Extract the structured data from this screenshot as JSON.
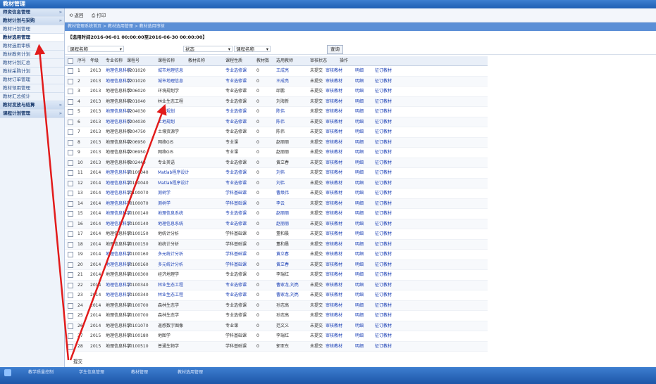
{
  "window": {
    "title": "教材管理"
  },
  "sidebar": {
    "items": [
      {
        "label": "师资信息管理",
        "group": true
      },
      {
        "label": "教材计划与采购",
        "group": true
      },
      {
        "label": "教材计划管理",
        "group": false
      },
      {
        "label": "教材选用管理",
        "group": false,
        "selected": true
      },
      {
        "label": "教材选用审核",
        "group": false
      },
      {
        "label": "教材教务计划",
        "group": false
      },
      {
        "label": "教材计划汇总",
        "group": false
      },
      {
        "label": "教材采购计划",
        "group": false
      },
      {
        "label": "教材订单管理",
        "group": false
      },
      {
        "label": "教材领用管理",
        "group": false
      },
      {
        "label": "教材汇总统计",
        "group": false
      },
      {
        "label": "教材发放与结算",
        "group": true
      },
      {
        "label": "课程计划管理",
        "group": true
      }
    ]
  },
  "toolbar": {
    "back_label": "返回",
    "print_label": "打印"
  },
  "breadcrumb": {
    "text": "教材管理系统首页 > 教材选用管理 > 教材选用审核"
  },
  "time_window": {
    "text": "【选用时间2016-06-01 00:00:00至2016-06-30 00:00:00】"
  },
  "filter": {
    "course_label": "课程名称",
    "status_label": "状态",
    "submit_label": "查询"
  },
  "table": {
    "columns": [
      "序号",
      "年级",
      "专业名称",
      "课程号",
      "课程名称",
      "教材名称",
      "课程性质",
      "教材数",
      "选用教师",
      "审核状态",
      "操作"
    ],
    "rows": [
      {
        "no": "1",
        "year": "2013",
        "major": "地理信息科学",
        "code": "0201020",
        "course": "城市地理信息",
        "type": "专业选修课",
        "count": "0",
        "teacher": "王成亮",
        "status": "未提交",
        "link": true
      },
      {
        "no": "2",
        "year": "2013",
        "major": "地理信息科学",
        "code": "0201020",
        "course": "城市地理信息",
        "type": "专业选修课",
        "count": "0",
        "teacher": "王成亮",
        "status": "未提交",
        "link": true
      },
      {
        "no": "3",
        "year": "2013",
        "major": "地理信息科学",
        "code": "0206020",
        "course": "环境规划学",
        "type": "专业选修课",
        "count": "0",
        "teacher": "邱鹏",
        "status": "未提交",
        "link": false
      },
      {
        "no": "4",
        "year": "2013",
        "major": "地理信息科学",
        "code": "0201040",
        "course": "林业生态工程",
        "type": "专业选修课",
        "count": "0",
        "teacher": "刘海新",
        "status": "未提交",
        "link": false
      },
      {
        "no": "5",
        "year": "2013",
        "major": "地理信息科学",
        "code": "0204030",
        "course": "土地规划",
        "type": "专业选修课",
        "count": "0",
        "teacher": "陈伟",
        "status": "未提交",
        "link": true
      },
      {
        "no": "6",
        "year": "2013",
        "major": "地理信息科学",
        "code": "0204030",
        "course": "土地规划",
        "type": "专业选修课",
        "count": "0",
        "teacher": "陈伟",
        "status": "未提交",
        "link": true
      },
      {
        "no": "7",
        "year": "2013",
        "major": "地理信息科学",
        "code": "0204750",
        "course": "土壤资源学",
        "type": "专业选修课",
        "count": "0",
        "teacher": "陈伟",
        "status": "未提交",
        "link": false
      },
      {
        "no": "8",
        "year": "2013",
        "major": "地理信息科学",
        "code": "0206950",
        "course": "网络GIS",
        "type": "专业课",
        "count": "0",
        "teacher": "赵丽丽",
        "status": "未提交",
        "link": false
      },
      {
        "no": "9",
        "year": "2013",
        "major": "地理信息科学",
        "code": "0206950",
        "course": "网络GIS",
        "type": "专业课",
        "count": "0",
        "teacher": "赵丽丽",
        "status": "未提交",
        "link": false
      },
      {
        "no": "10",
        "year": "2013",
        "major": "地理信息科学",
        "code": "0202440",
        "course": "专业英语",
        "type": "专业选修课",
        "count": "0",
        "teacher": "黄立春",
        "status": "未提交",
        "link": false
      },
      {
        "no": "11",
        "year": "2014",
        "major": "地理信息科学",
        "code": "10100040",
        "course": "Matlab程序设计",
        "type": "专业选修课",
        "count": "0",
        "teacher": "刘伟",
        "status": "未提交",
        "link": true
      },
      {
        "no": "12",
        "year": "2014",
        "major": "地理信息科学",
        "code": "10100040",
        "course": "Matlab程序设计",
        "type": "专业选修课",
        "count": "0",
        "teacher": "刘伟",
        "status": "未提交",
        "link": true
      },
      {
        "no": "13",
        "year": "2014",
        "major": "地理信息科学",
        "code": "10100070",
        "course": "测树学",
        "type": "学科基础课",
        "count": "0",
        "teacher": "曹焕伟",
        "status": "未提交",
        "link": true
      },
      {
        "no": "14",
        "year": "2014",
        "major": "地理信息科学",
        "code": "10100070",
        "course": "测树学",
        "type": "学科基础课",
        "count": "0",
        "teacher": "李云",
        "status": "未提交",
        "link": true
      },
      {
        "no": "15",
        "year": "2014",
        "major": "地理信息科学",
        "code": "10100140",
        "course": "地理信息系统",
        "type": "专业选修课",
        "count": "0",
        "teacher": "赵丽丽",
        "status": "未提交",
        "link": true
      },
      {
        "no": "16",
        "year": "2014",
        "major": "地理信息科学",
        "code": "10100140",
        "course": "地理信息系统",
        "type": "专业选修课",
        "count": "0",
        "teacher": "赵丽丽",
        "status": "未提交",
        "link": true
      },
      {
        "no": "17",
        "year": "2014",
        "major": "地理信息科学",
        "code": "10100150",
        "course": "地统计分析",
        "type": "学科基础课",
        "count": "0",
        "teacher": "董和晨",
        "status": "未提交",
        "link": false
      },
      {
        "no": "18",
        "year": "2014",
        "major": "地理信息科学",
        "code": "10100150",
        "course": "地统计分析",
        "type": "学科基础课",
        "count": "0",
        "teacher": "董和晨",
        "status": "未提交",
        "link": false
      },
      {
        "no": "19",
        "year": "2014",
        "major": "地理信息科学",
        "code": "10100160",
        "course": "多元统计分析",
        "type": "学科基础课",
        "count": "0",
        "teacher": "黄立春",
        "status": "未提交",
        "link": true
      },
      {
        "no": "20",
        "year": "2014",
        "major": "地理信息科学",
        "code": "10100160",
        "course": "多元统计分析",
        "type": "学科基础课",
        "count": "0",
        "teacher": "黄立春",
        "status": "未提交",
        "link": true
      },
      {
        "no": "21",
        "year": "2014",
        "major": "地理信息科学",
        "code": "10100300",
        "course": "经济地理学",
        "type": "专业选修课",
        "count": "0",
        "teacher": "李瑞红",
        "status": "未提交",
        "link": false
      },
      {
        "no": "22",
        "year": "2014",
        "major": "地理信息科学",
        "code": "10100340",
        "course": "林业生态工程",
        "type": "专业选修课",
        "count": "0",
        "teacher": "曹家龙,刘亮",
        "status": "未提交",
        "link": true
      },
      {
        "no": "23",
        "year": "2014",
        "major": "地理信息科学",
        "code": "10100340",
        "course": "林业生态工程",
        "type": "专业选修课",
        "count": "0",
        "teacher": "曹家龙,刘亮",
        "status": "未提交",
        "link": true
      },
      {
        "no": "24",
        "year": "2014",
        "major": "地理信息科学",
        "code": "10100700",
        "course": "森林生态学",
        "type": "专业选修课",
        "count": "0",
        "teacher": "孙志高",
        "status": "未提交",
        "link": false
      },
      {
        "no": "25",
        "year": "2014",
        "major": "地理信息科学",
        "code": "10100700",
        "course": "森林生态学",
        "type": "专业选修课",
        "count": "0",
        "teacher": "孙志高",
        "status": "未提交",
        "link": false
      },
      {
        "no": "26",
        "year": "2014",
        "major": "地理信息科学",
        "code": "10101070",
        "course": "遥感数字图像",
        "type": "专业课",
        "count": "0",
        "teacher": "范文义",
        "status": "未提交",
        "link": false
      },
      {
        "no": "27",
        "year": "2015",
        "major": "地理信息科学",
        "code": "10100180",
        "course": "地图学",
        "type": "学科基础课",
        "count": "0",
        "teacher": "李瑞红",
        "status": "未提交",
        "link": false
      },
      {
        "no": "28",
        "year": "2015",
        "major": "地理信息科学",
        "code": "10100510",
        "course": "普通生物学",
        "type": "学科基础课",
        "count": "0",
        "teacher": "郭亚东",
        "status": "未提交",
        "link": false
      }
    ],
    "action_view": "审核教材",
    "action_detail": "明细",
    "action_order": "征订教材",
    "footer": "提交"
  },
  "taskbar": {
    "items": [
      "教学质量控制",
      "学生信息管理",
      "教材管理",
      "教材选用管理"
    ]
  },
  "colors": {
    "accent": "#1f5fb3",
    "link": "#1a3fb5",
    "annotation": "#e21b1b"
  }
}
